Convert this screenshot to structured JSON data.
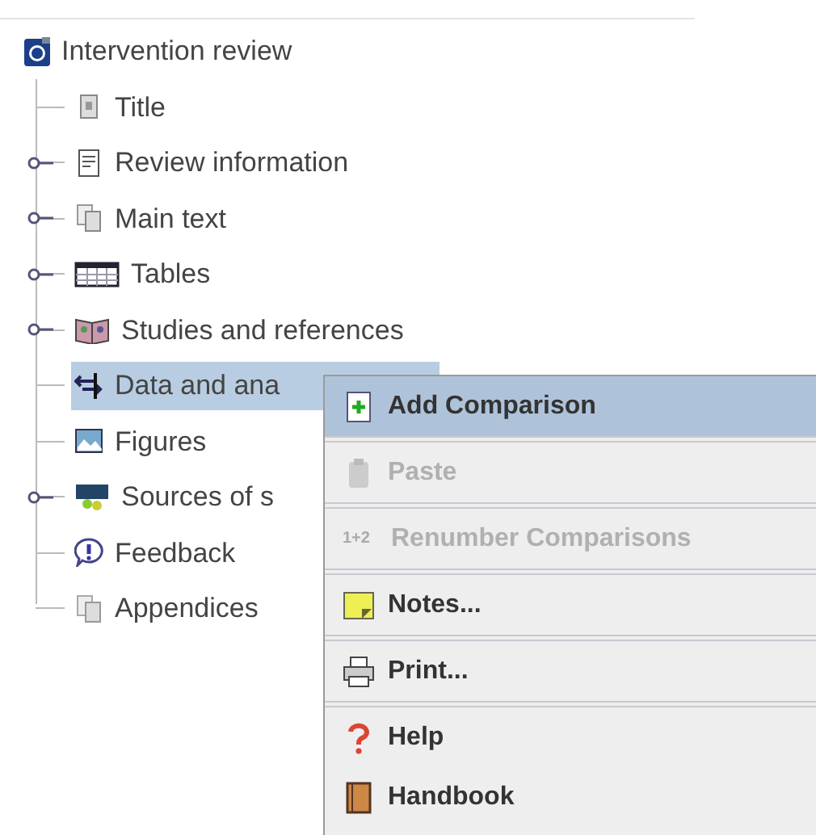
{
  "tree": {
    "root": {
      "label": "Intervention review"
    },
    "items": [
      {
        "kind": "title",
        "label": "Title",
        "expandable": false,
        "selected": false
      },
      {
        "kind": "info",
        "label": "Review information",
        "expandable": true,
        "selected": false
      },
      {
        "kind": "text",
        "label": "Main text",
        "expandable": true,
        "selected": false
      },
      {
        "kind": "tables",
        "label": "Tables",
        "expandable": true,
        "selected": false
      },
      {
        "kind": "studies",
        "label": "Studies and references",
        "expandable": true,
        "selected": false
      },
      {
        "kind": "data",
        "label": "Data and ana",
        "expandable": false,
        "selected": true
      },
      {
        "kind": "figures",
        "label": "Figures",
        "expandable": false,
        "selected": false
      },
      {
        "kind": "sources",
        "label": "Sources of s",
        "expandable": true,
        "selected": false
      },
      {
        "kind": "feedback",
        "label": "Feedback",
        "expandable": false,
        "selected": false
      },
      {
        "kind": "appendices",
        "label": "Appendices",
        "expandable": false,
        "selected": false
      }
    ]
  },
  "context_menu": {
    "groups": [
      [
        {
          "kind": "add",
          "label": "Add Comparison",
          "selected": true,
          "disabled": false
        }
      ],
      [
        {
          "kind": "paste",
          "label": "Paste",
          "selected": false,
          "disabled": true
        }
      ],
      [
        {
          "kind": "renumber",
          "icon_text": "1+2",
          "label": "Renumber Comparisons",
          "selected": false,
          "disabled": true
        }
      ],
      [
        {
          "kind": "notes",
          "label": "Notes...",
          "selected": false,
          "disabled": false
        }
      ],
      [
        {
          "kind": "print",
          "label": "Print...",
          "selected": false,
          "disabled": false
        }
      ],
      [
        {
          "kind": "help",
          "label": "Help",
          "selected": false,
          "disabled": false
        },
        {
          "kind": "handbook",
          "label": "Handbook",
          "selected": false,
          "disabled": false
        }
      ]
    ]
  }
}
